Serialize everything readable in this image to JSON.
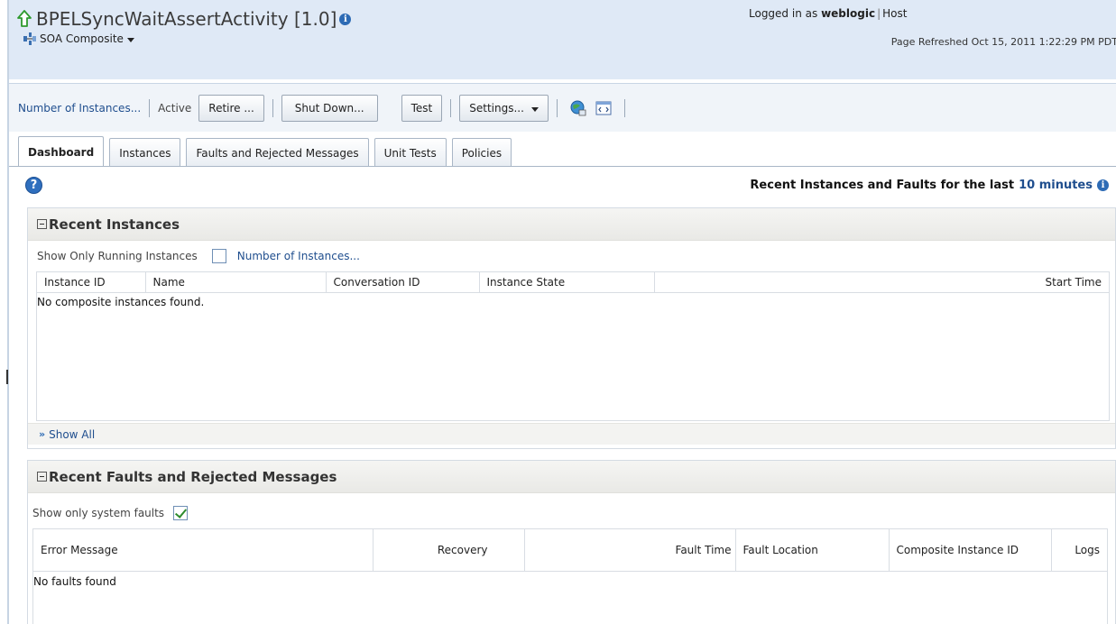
{
  "header": {
    "title": "BPELSyncWaitAssertActivity [1.0]",
    "composite_menu": "SOA Composite",
    "logged_in_label": "Logged in as",
    "user": "weblogic",
    "host": "Host",
    "refreshed": "Page Refreshed Oct 15, 2011 1:22:29 PM PDT"
  },
  "toolbar": {
    "instances_link": "Number of Instances...",
    "state": "Active",
    "retire": "Retire ...",
    "shutdown": "Shut Down...",
    "test": "Test",
    "settings": "Settings..."
  },
  "tabs": [
    {
      "label": "Dashboard",
      "active": true
    },
    {
      "label": "Instances"
    },
    {
      "label": "Faults and Rejected Messages"
    },
    {
      "label": "Unit Tests"
    },
    {
      "label": "Policies"
    }
  ],
  "recent": {
    "prefix": "Recent Instances and Faults for the last",
    "period": "10 minutes"
  },
  "instances_panel": {
    "title": "Recent Instances",
    "filter_label": "Show Only Running Instances",
    "filter_checked": false,
    "instances_link": "Number of Instances...",
    "columns": [
      "Instance ID",
      "Name",
      "Conversation ID",
      "Instance State",
      "Start Time"
    ],
    "empty_text": "No composite instances found.",
    "show_all": "Show All"
  },
  "faults_panel": {
    "title": "Recent Faults and Rejected Messages",
    "filter_label": "Show only system faults",
    "filter_checked": true,
    "columns": [
      "Error Message",
      "Recovery",
      "Fault Time",
      "Fault Location",
      "Composite Instance ID",
      "Logs"
    ],
    "empty_text": "No faults found"
  }
}
